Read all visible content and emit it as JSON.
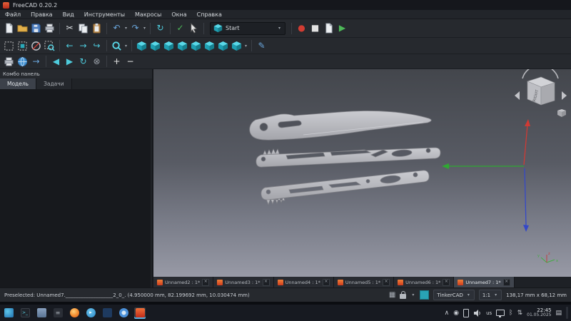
{
  "window": {
    "title": "FreeCAD 0.20.2"
  },
  "menubar": {
    "items": [
      "Файл",
      "Правка",
      "Вид",
      "Инструменты",
      "Макросы",
      "Окна",
      "Справка"
    ]
  },
  "toolbars": {
    "workbench_selected": "Start"
  },
  "combo_panel": {
    "title": "Комбо панель",
    "tabs": [
      "Модель",
      "Задачи"
    ],
    "active_tab": "Модель"
  },
  "navcube": {
    "face_label": "RIGHT"
  },
  "axes_indicator": {
    "x": "x",
    "y": "y",
    "z": "z"
  },
  "doc_tabs": [
    {
      "label": "Unnamed2 : 1*",
      "active": false
    },
    {
      "label": "Unnamed3 : 1*",
      "active": false
    },
    {
      "label": "Unnamed4 : 1*",
      "active": false
    },
    {
      "label": "Unnamed5 : 1*",
      "active": false
    },
    {
      "label": "Unnamed6 : 1*",
      "active": false
    },
    {
      "label": "Unnamed7 : 1*",
      "active": true
    }
  ],
  "statusbar": {
    "message": "Preselected: Unnamed7.___________________2_0_. (4.950000 mm, 82.199692 mm, 10.030474 mm)",
    "nav_style": "TinkerCAD",
    "scale": "1:1",
    "dimensions": "138,17 mm x 68,12 mm"
  },
  "taskbar": {
    "keyboard_layout": "us",
    "time": "22:45",
    "date": "01.05.2025"
  },
  "icons": {
    "cut": "✂",
    "undo": "↶",
    "redo": "↷",
    "refresh": "↻",
    "check": "✓",
    "record": "●",
    "stop": "■",
    "play": "▶",
    "back": "←",
    "forward": "→",
    "link": "↪",
    "dropdown": "▾",
    "nav_back": "◀",
    "nav_forward": "▶",
    "web_refresh": "↻",
    "web_stop": "⊗",
    "zoom_in": "+",
    "zoom_out": "−",
    "measure": "✎",
    "grid": "▦",
    "media": "◉",
    "bluetooth": "ᛒ",
    "network": "⇅",
    "notifications": "▤",
    "telegram_arrow": "▸",
    "terminal_prompt": ">_",
    "menu_lines": "≡"
  }
}
